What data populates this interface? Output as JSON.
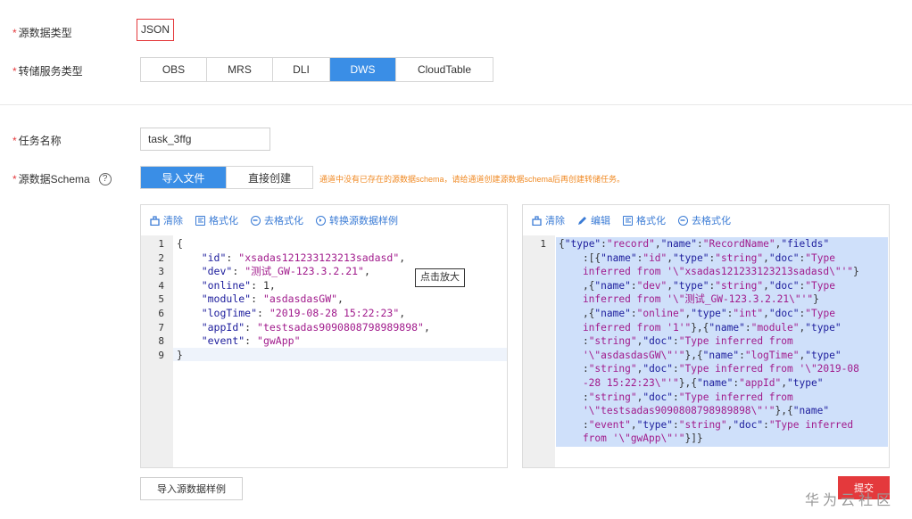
{
  "form": {
    "source_type_label": "源数据类型",
    "source_type_value": "JSON",
    "dump_service_label": "转储服务类型",
    "dump_options": [
      "OBS",
      "MRS",
      "DLI",
      "DWS",
      "CloudTable"
    ],
    "dump_selected": "DWS",
    "task_name_label": "任务名称",
    "task_name_value": "task_3ffg",
    "schema_label": "源数据Schema",
    "schema_help": "?",
    "schema_tabs": [
      "导入文件",
      "直接创建"
    ],
    "schema_tab_selected": "导入文件",
    "warning": "通道中没有已存在的源数据schema，请给通道创建源数据schema后再创建转储任务。"
  },
  "left_editor": {
    "toolbar": [
      {
        "icon": "clear-icon",
        "label": "清除"
      },
      {
        "icon": "format-icon",
        "label": "格式化"
      },
      {
        "icon": "unformat-icon",
        "label": "去格式化"
      },
      {
        "icon": "convert-icon",
        "label": "转换源数据样例"
      }
    ],
    "line_numbers": [
      "1",
      "2",
      "3",
      "4",
      "5",
      "6",
      "7",
      "8",
      "9"
    ],
    "lines": [
      [
        {
          "t": "p",
          "v": "{"
        }
      ],
      [
        {
          "t": "p",
          "v": "    "
        },
        {
          "t": "k",
          "v": "\"id\""
        },
        {
          "t": "p",
          "v": ": "
        },
        {
          "t": "s",
          "v": "\"xsadas121233123213sadasd\""
        },
        {
          "t": "p",
          "v": ","
        }
      ],
      [
        {
          "t": "p",
          "v": "    "
        },
        {
          "t": "k",
          "v": "\"dev\""
        },
        {
          "t": "p",
          "v": ": "
        },
        {
          "t": "s",
          "v": "\"测试_GW-123.3.2.21\""
        },
        {
          "t": "p",
          "v": ","
        }
      ],
      [
        {
          "t": "p",
          "v": "    "
        },
        {
          "t": "k",
          "v": "\"online\""
        },
        {
          "t": "p",
          "v": ": 1,"
        }
      ],
      [
        {
          "t": "p",
          "v": "    "
        },
        {
          "t": "k",
          "v": "\"module\""
        },
        {
          "t": "p",
          "v": ": "
        },
        {
          "t": "s",
          "v": "\"asdasdasGW\""
        },
        {
          "t": "p",
          "v": ","
        }
      ],
      [
        {
          "t": "p",
          "v": "    "
        },
        {
          "t": "k",
          "v": "\"logTime\""
        },
        {
          "t": "p",
          "v": ": "
        },
        {
          "t": "s",
          "v": "\"2019-08-28 15:22:23\""
        },
        {
          "t": "p",
          "v": ","
        }
      ],
      [
        {
          "t": "p",
          "v": "    "
        },
        {
          "t": "k",
          "v": "\"appId\""
        },
        {
          "t": "p",
          "v": ": "
        },
        {
          "t": "s",
          "v": "\"testsadas9090808798989898\""
        },
        {
          "t": "p",
          "v": ","
        }
      ],
      [
        {
          "t": "p",
          "v": "    "
        },
        {
          "t": "k",
          "v": "\"event\""
        },
        {
          "t": "p",
          "v": ": "
        },
        {
          "t": "s",
          "v": "\"gwApp\""
        }
      ],
      [
        {
          "t": "p",
          "v": "}"
        }
      ]
    ],
    "tooltip": "点击放大"
  },
  "right_editor": {
    "toolbar": [
      {
        "icon": "clear-icon",
        "label": "清除"
      },
      {
        "icon": "edit-icon",
        "label": "编辑"
      },
      {
        "icon": "format-icon",
        "label": "格式化"
      },
      {
        "icon": "unformat-icon",
        "label": "去格式化"
      }
    ],
    "line_numbers": [
      "1"
    ],
    "lines": [
      [
        {
          "t": "p",
          "v": "{"
        },
        {
          "t": "k",
          "v": "\"type\""
        },
        {
          "t": "p",
          "v": ":"
        },
        {
          "t": "s",
          "v": "\"record\""
        },
        {
          "t": "p",
          "v": ","
        },
        {
          "t": "k",
          "v": "\"name\""
        },
        {
          "t": "p",
          "v": ":"
        },
        {
          "t": "s",
          "v": "\"RecordName\""
        },
        {
          "t": "p",
          "v": ","
        },
        {
          "t": "k",
          "v": "\"fields\""
        }
      ],
      [
        {
          "t": "p",
          "v": "    :[{"
        },
        {
          "t": "k",
          "v": "\"name\""
        },
        {
          "t": "p",
          "v": ":"
        },
        {
          "t": "s",
          "v": "\"id\""
        },
        {
          "t": "p",
          "v": ","
        },
        {
          "t": "k",
          "v": "\"type\""
        },
        {
          "t": "p",
          "v": ":"
        },
        {
          "t": "s",
          "v": "\"string\""
        },
        {
          "t": "p",
          "v": ","
        },
        {
          "t": "k",
          "v": "\"doc\""
        },
        {
          "t": "p",
          "v": ":"
        },
        {
          "t": "s",
          "v": "\"Type"
        }
      ],
      [
        {
          "t": "s",
          "v": "    inferred from '\\\"xsadas121233123213sadasd\\\"'\""
        },
        {
          "t": "p",
          "v": "}"
        }
      ],
      [
        {
          "t": "p",
          "v": "    ,{"
        },
        {
          "t": "k",
          "v": "\"name\""
        },
        {
          "t": "p",
          "v": ":"
        },
        {
          "t": "s",
          "v": "\"dev\""
        },
        {
          "t": "p",
          "v": ","
        },
        {
          "t": "k",
          "v": "\"type\""
        },
        {
          "t": "p",
          "v": ":"
        },
        {
          "t": "s",
          "v": "\"string\""
        },
        {
          "t": "p",
          "v": ","
        },
        {
          "t": "k",
          "v": "\"doc\""
        },
        {
          "t": "p",
          "v": ":"
        },
        {
          "t": "s",
          "v": "\"Type"
        }
      ],
      [
        {
          "t": "s",
          "v": "    inferred from '\\\"测试_GW-123.3.2.21\\\"'\""
        },
        {
          "t": "p",
          "v": "}"
        }
      ],
      [
        {
          "t": "p",
          "v": "    ,{"
        },
        {
          "t": "k",
          "v": "\"name\""
        },
        {
          "t": "p",
          "v": ":"
        },
        {
          "t": "s",
          "v": "\"online\""
        },
        {
          "t": "p",
          "v": ","
        },
        {
          "t": "k",
          "v": "\"type\""
        },
        {
          "t": "p",
          "v": ":"
        },
        {
          "t": "s",
          "v": "\"int\""
        },
        {
          "t": "p",
          "v": ","
        },
        {
          "t": "k",
          "v": "\"doc\""
        },
        {
          "t": "p",
          "v": ":"
        },
        {
          "t": "s",
          "v": "\"Type"
        }
      ],
      [
        {
          "t": "s",
          "v": "    inferred from '1'\""
        },
        {
          "t": "p",
          "v": "},{"
        },
        {
          "t": "k",
          "v": "\"name\""
        },
        {
          "t": "p",
          "v": ":"
        },
        {
          "t": "s",
          "v": "\"module\""
        },
        {
          "t": "p",
          "v": ","
        },
        {
          "t": "k",
          "v": "\"type\""
        }
      ],
      [
        {
          "t": "p",
          "v": "    :"
        },
        {
          "t": "s",
          "v": "\"string\""
        },
        {
          "t": "p",
          "v": ","
        },
        {
          "t": "k",
          "v": "\"doc\""
        },
        {
          "t": "p",
          "v": ":"
        },
        {
          "t": "s",
          "v": "\"Type inferred from"
        }
      ],
      [
        {
          "t": "s",
          "v": "    '\\\"asdasdasGW\\\"'\""
        },
        {
          "t": "p",
          "v": "},{"
        },
        {
          "t": "k",
          "v": "\"name\""
        },
        {
          "t": "p",
          "v": ":"
        },
        {
          "t": "s",
          "v": "\"logTime\""
        },
        {
          "t": "p",
          "v": ","
        },
        {
          "t": "k",
          "v": "\"type\""
        }
      ],
      [
        {
          "t": "p",
          "v": "    :"
        },
        {
          "t": "s",
          "v": "\"string\""
        },
        {
          "t": "p",
          "v": ","
        },
        {
          "t": "k",
          "v": "\"doc\""
        },
        {
          "t": "p",
          "v": ":"
        },
        {
          "t": "s",
          "v": "\"Type inferred from '\\\"2019-08"
        }
      ],
      [
        {
          "t": "s",
          "v": "    -28 15:22:23\\\"'\""
        },
        {
          "t": "p",
          "v": "},{"
        },
        {
          "t": "k",
          "v": "\"name\""
        },
        {
          "t": "p",
          "v": ":"
        },
        {
          "t": "s",
          "v": "\"appId\""
        },
        {
          "t": "p",
          "v": ","
        },
        {
          "t": "k",
          "v": "\"type\""
        }
      ],
      [
        {
          "t": "p",
          "v": "    :"
        },
        {
          "t": "s",
          "v": "\"string\""
        },
        {
          "t": "p",
          "v": ","
        },
        {
          "t": "k",
          "v": "\"doc\""
        },
        {
          "t": "p",
          "v": ":"
        },
        {
          "t": "s",
          "v": "\"Type inferred from"
        }
      ],
      [
        {
          "t": "s",
          "v": "    '\\\"testsadas9090808798989898\\\"'\""
        },
        {
          "t": "p",
          "v": "},{"
        },
        {
          "t": "k",
          "v": "\"name\""
        }
      ],
      [
        {
          "t": "p",
          "v": "    :"
        },
        {
          "t": "s",
          "v": "\"event\""
        },
        {
          "t": "p",
          "v": ","
        },
        {
          "t": "k",
          "v": "\"type\""
        },
        {
          "t": "p",
          "v": ":"
        },
        {
          "t": "s",
          "v": "\"string\""
        },
        {
          "t": "p",
          "v": ","
        },
        {
          "t": "k",
          "v": "\"doc\""
        },
        {
          "t": "p",
          "v": ":"
        },
        {
          "t": "s",
          "v": "\"Type inferred"
        }
      ],
      [
        {
          "t": "s",
          "v": "    from '\\\"gwApp\\\"'\""
        },
        {
          "t": "p",
          "v": "}]}"
        }
      ]
    ]
  },
  "footer": {
    "import_sample_label": "导入源数据样例",
    "submit_label": "提交",
    "watermark": "华为云社区"
  },
  "colors": {
    "accent": "#3a8ee6",
    "danger": "#e4393c",
    "warning": "#f08a24",
    "selection": "#cfe0fa"
  }
}
